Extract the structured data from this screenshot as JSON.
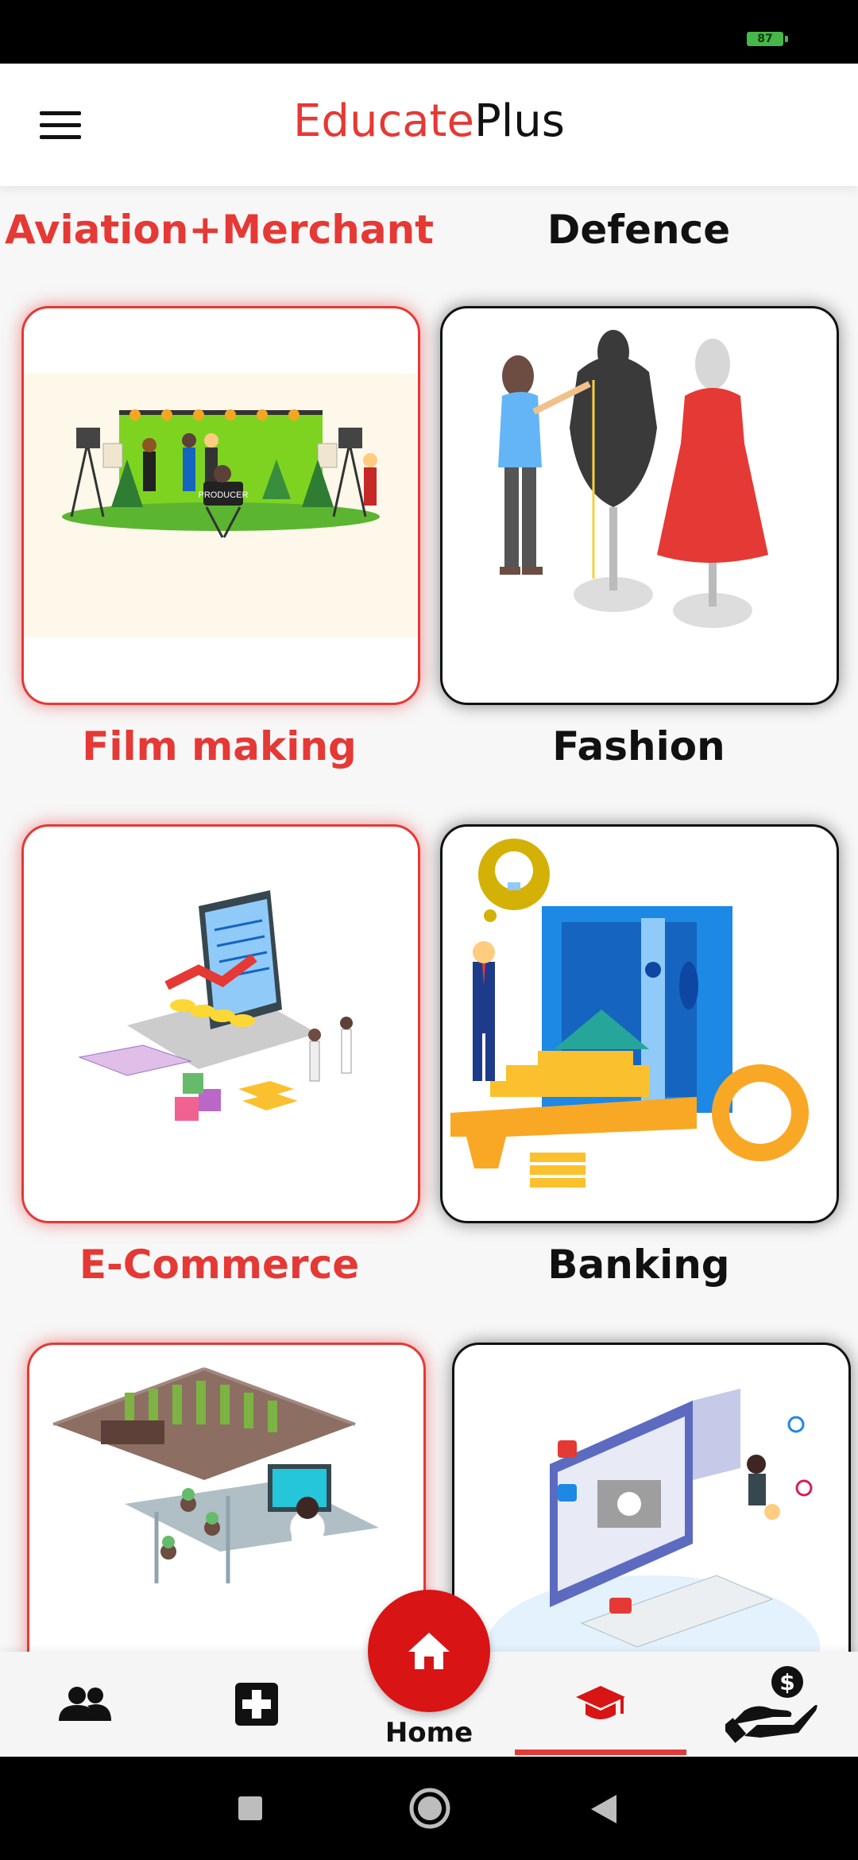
{
  "status_bar": {
    "battery": "87"
  },
  "app_bar": {
    "title_part1": "Educate",
    "title_part2": "Plus"
  },
  "categories": {
    "top_left_label": "Aviation+Merchant",
    "top_right_label": "Defence",
    "row1_left": {
      "label": "Film making",
      "image_text": "PRODUCER"
    },
    "row1_right": {
      "label": "Fashion"
    },
    "row2_left": {
      "label": "E-Commerce"
    },
    "row2_right": {
      "label": "Banking"
    }
  },
  "bottom_nav": {
    "home_label": "Home"
  },
  "icons": {
    "menu": "hamburger-menu-icon",
    "people": "people-icon",
    "medical": "medical-cross-icon",
    "home": "home-icon",
    "education": "graduation-cap-icon",
    "money": "money-hand-icon"
  },
  "colors": {
    "accent": "#e53935",
    "fab": "#d81414",
    "text": "#111111"
  }
}
